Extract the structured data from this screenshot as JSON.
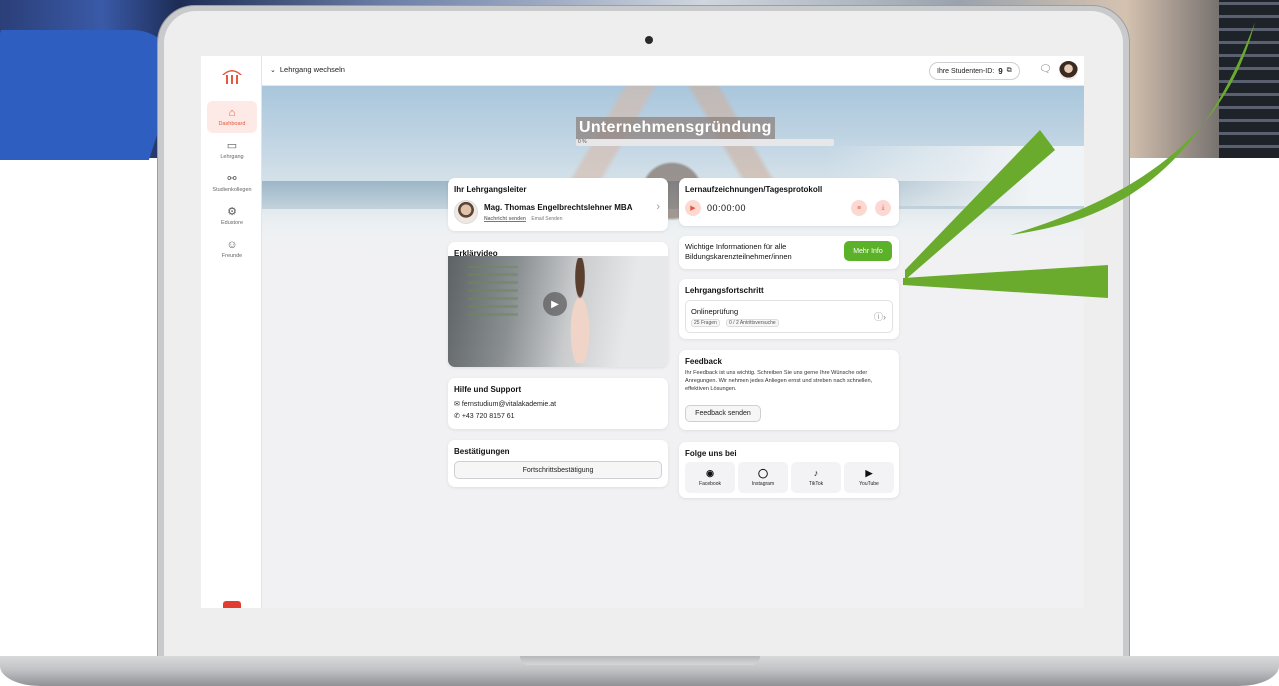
{
  "topbar": {
    "course_switch_label": "Lehrgang wechseln",
    "student_id_label": "Ihre Studenten-ID:",
    "student_id_value": "9",
    "copy_icon": "copy-icon",
    "chat_icon": "chat-icon"
  },
  "sidebar": {
    "items": [
      {
        "label": "Dashboard",
        "icon": "home-icon",
        "active": true
      },
      {
        "label": "Lehrgang",
        "icon": "folder-icon",
        "active": false
      },
      {
        "label": "Studienkollegen",
        "icon": "users-icon",
        "active": false
      },
      {
        "label": "Edustore",
        "icon": "cart-icon",
        "active": false
      },
      {
        "label": "Freunde",
        "icon": "friends-icon",
        "active": false
      }
    ]
  },
  "hero": {
    "title": "Unternehmensgründung",
    "progress_text": "0 %",
    "progress_value": 0
  },
  "leader_card": {
    "title": "Ihr Lehrgangsleiter",
    "name": "Mag. Thomas Engelbrechtslehner MBA",
    "message_link": "Nachricht senden",
    "email_link": "Email Senden"
  },
  "video_card": {
    "title": "Erklärvideo"
  },
  "support_card": {
    "title": "Hilfe und Support",
    "email": "fernstudium@vitalakademie.at",
    "phone": "+43 720 8157 61"
  },
  "confirm_card": {
    "title": "Bestätigungen",
    "button": "Fortschrittsbestätigung"
  },
  "recording_card": {
    "title": "Lernaufzeichnungen/Tagesprotokoll",
    "timer": "00:00:00"
  },
  "info_card": {
    "text_line1": "Wichtige Informationen für alle",
    "text_line2": "Bildungskarenzteilnehmer/innen",
    "button": "Mehr Info"
  },
  "progress_card": {
    "title": "Lehrgangsfortschritt",
    "exam_title": "Onlineprüfung",
    "badge1": "25 Fragen",
    "badge2": "0 / 2 Antrittsversuche"
  },
  "feedback_card": {
    "title": "Feedback",
    "text": "Ihr Feedback ist uns wichtig. Schreiben Sie uns gerne Ihre Wünsche oder Anregungen. Wir nehmen jedes Anliegen ernst und streben nach schnellen, effektiven Lösungen.",
    "button": "Feedback senden"
  },
  "social_card": {
    "title": "Folge uns bei",
    "items": [
      {
        "label": "Facebook",
        "icon": "facebook-icon"
      },
      {
        "label": "Instagram",
        "icon": "instagram-icon"
      },
      {
        "label": "TikTok",
        "icon": "tiktok-icon"
      },
      {
        "label": "YouTube",
        "icon": "youtube-icon"
      }
    ]
  },
  "colors": {
    "accent": "#e5583d",
    "green": "#5bb128",
    "arrow_green": "#6aab2e"
  }
}
